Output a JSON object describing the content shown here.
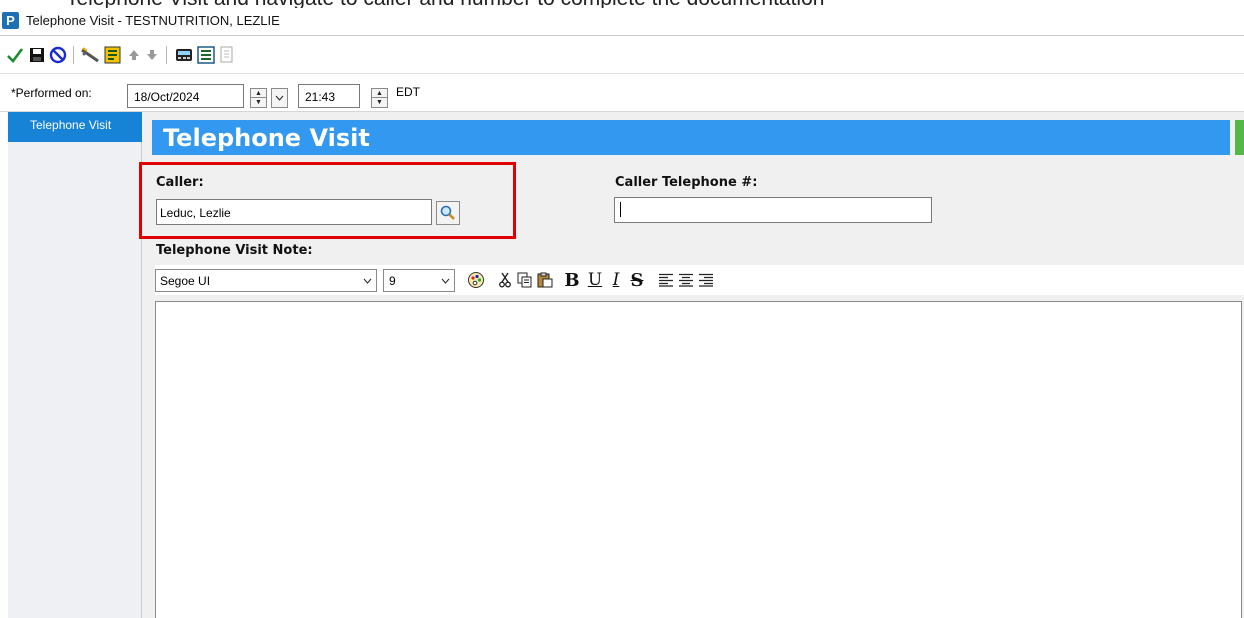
{
  "window": {
    "top_strip_text": "Telephone Visit and navigate to caller and number to complete the documentation",
    "app_icon_letter": "P",
    "title": "Telephone Visit - TESTNUTRITION, LEZLIE"
  },
  "toolbar": {
    "icons": [
      "checkmark-icon",
      "save-icon",
      "cancel-icon",
      "wand-icon",
      "template-icon",
      "up-arrow-icon",
      "down-arrow-icon",
      "calculator-icon",
      "form-icon",
      "document-icon"
    ]
  },
  "performed_on": {
    "label": "*Performed on:",
    "date": "18/Oct/2024",
    "time": "21:43",
    "timezone": "EDT"
  },
  "sidebar": {
    "items": [
      {
        "label": "Telephone Visit",
        "selected": true
      }
    ]
  },
  "form": {
    "header": "Telephone Visit",
    "caller_label": "Caller:",
    "caller_value": "Leduc, Lezlie",
    "phone_label": "Caller Telephone #:",
    "phone_value": "",
    "note_label": "Telephone Visit Note:",
    "font_name": "Segoe UI",
    "font_size": "9",
    "note_text": ""
  },
  "colors": {
    "header_blue": "#3398ef",
    "sidebar_selected": "#1683d6",
    "highlight_red": "#e00000",
    "accent_green": "#53b848"
  }
}
